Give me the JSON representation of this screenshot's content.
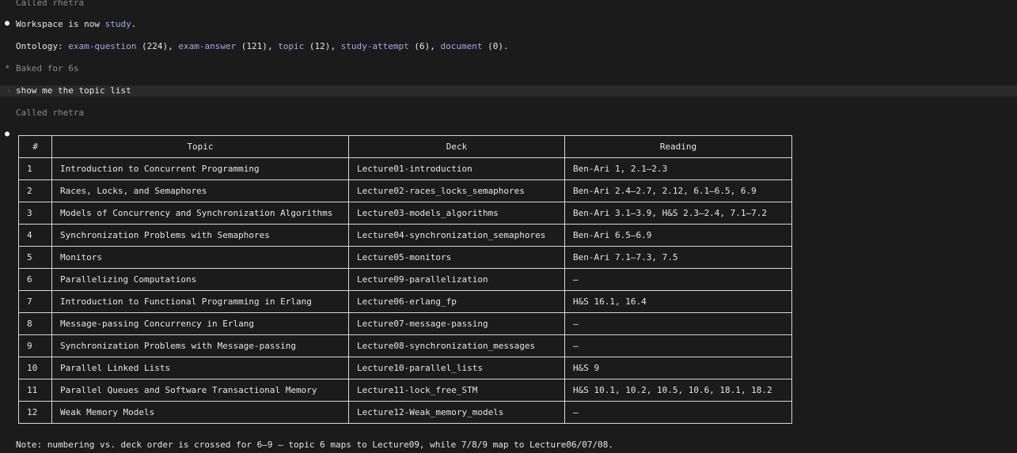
{
  "transcript": {
    "called_top": "Called rhetra",
    "workspace_prefix": "Workspace is now ",
    "workspace_name": "study",
    "workspace_suffix": ".",
    "ontology_label": "Ontology: ",
    "ontology": [
      {
        "name": "exam-question",
        "count": " (224)",
        "sep": ", "
      },
      {
        "name": "exam-answer",
        "count": " (121)",
        "sep": ", "
      },
      {
        "name": "topic",
        "count": " (12)",
        "sep": ", "
      },
      {
        "name": "study-attempt",
        "count": " (6)",
        "sep": ", "
      },
      {
        "name": "document",
        "count": " (0)",
        "sep": "."
      }
    ],
    "baked_icon": "*",
    "baked": "Baked for 6s",
    "prompt_caret": "›",
    "prompt": "show me the topic list",
    "called_2": "Called rhetra",
    "note": "Note: numbering vs. deck order is crossed for 6–9 — topic 6 maps to Lecture09, while 7/8/9 map to Lecture06/07/08."
  },
  "table": {
    "headers": [
      "#",
      "Topic",
      "Deck",
      "Reading"
    ],
    "rows": [
      [
        "1",
        "Introduction to Concurrent Programming",
        "Lecture01-introduction",
        "Ben-Ari 1, 2.1–2.3"
      ],
      [
        "2",
        "Races, Locks, and Semaphores",
        "Lecture02-races_locks_semaphores",
        "Ben-Ari 2.4–2.7, 2.12, 6.1–6.5, 6.9"
      ],
      [
        "3",
        "Models of Concurrency and Synchronization Algorithms",
        "Lecture03-models_algorithms",
        "Ben-Ari 3.1–3.9, H&S 2.3–2.4, 7.1–7.2"
      ],
      [
        "4",
        "Synchronization Problems with Semaphores",
        "Lecture04-synchronization_semaphores",
        "Ben-Ari 6.5–6.9"
      ],
      [
        "5",
        "Monitors",
        "Lecture05-monitors",
        "Ben-Ari 7.1–7.3, 7.5"
      ],
      [
        "6",
        "Parallelizing Computations",
        "Lecture09-parallelization",
        "—"
      ],
      [
        "7",
        "Introduction to Functional Programming in Erlang",
        "Lecture06-erlang_fp",
        "H&S 16.1, 16.4"
      ],
      [
        "8",
        "Message-passing Concurrency in Erlang",
        "Lecture07-message-passing",
        "—"
      ],
      [
        "9",
        "Synchronization Problems with Message-passing",
        "Lecture08-synchronization_messages",
        "—"
      ],
      [
        "10",
        "Parallel Linked Lists",
        "Lecture10-parallel_lists",
        "H&S 9"
      ],
      [
        "11",
        "Parallel Queues and Software Transactional Memory",
        "Lecture11-lock_free_STM",
        "H&S 10.1, 10.2, 10.5, 10.6, 18.1, 18.2"
      ],
      [
        "12",
        "Weak Memory Models",
        "Lecture12-Weak_memory_models",
        "—"
      ]
    ]
  }
}
